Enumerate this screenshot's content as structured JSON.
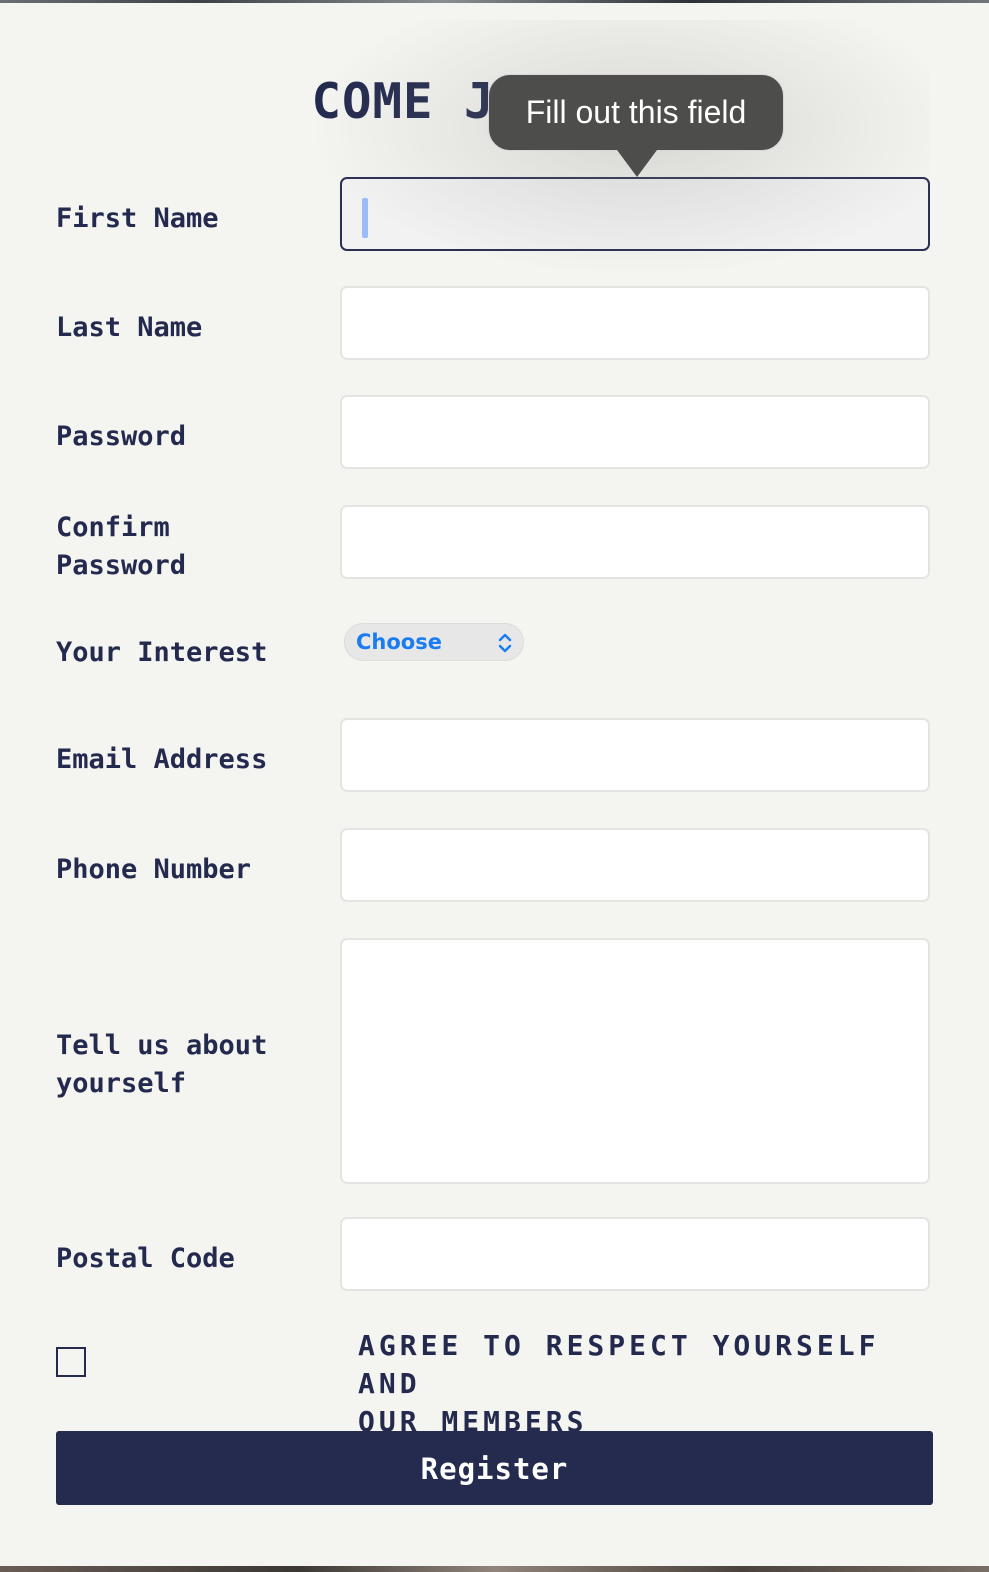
{
  "form": {
    "title": "COME JOIN US",
    "labels": {
      "first_name": "First Name",
      "last_name": "Last Name",
      "password": "Password",
      "confirm_password_line1": "Confirm",
      "confirm_password_line2": "Password",
      "interest": "Your Interest",
      "email": "Email Address",
      "phone": "Phone Number",
      "about_line1": "Tell us about",
      "about_line2": "yourself",
      "postal": "Postal Code"
    },
    "values": {
      "first_name": "",
      "last_name": "",
      "password": "",
      "confirm_password": "",
      "email": "",
      "phone": "",
      "about": "",
      "postal": ""
    },
    "interest_select": {
      "selected": "Choose",
      "icon": "chevron-up-down-icon"
    },
    "agree_checked": false,
    "agree_line1": "AGREE TO RESPECT YOURSELF AND",
    "agree_line2": "OUR MEMBERS",
    "register_label": "Register"
  },
  "validation_tooltip": {
    "text": "Fill out this field"
  },
  "colors": {
    "ink": "#242a4e",
    "button": "#252b4f",
    "select_text": "#1a7cf0",
    "tooltip_bg": "#4d4d4b",
    "card_bg": "#f4f4f1"
  }
}
